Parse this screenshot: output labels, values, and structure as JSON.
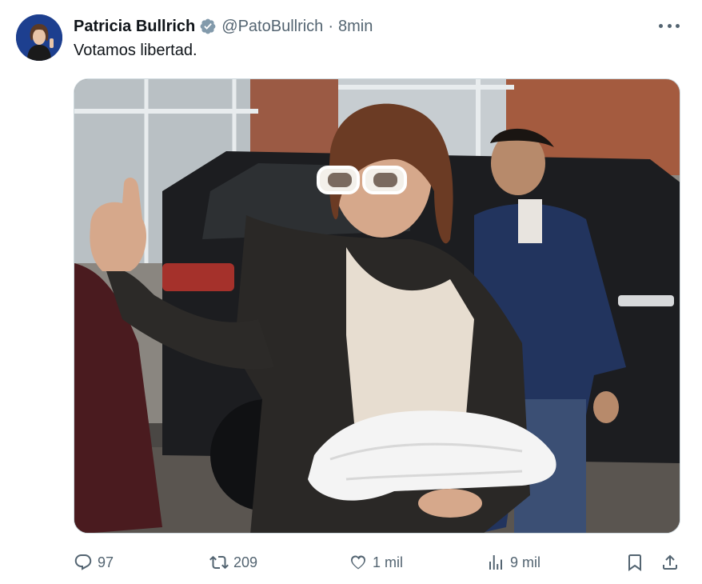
{
  "tweet": {
    "author_name": "Patricia Bullrich",
    "handle": "@PatoBullrich",
    "separator": "·",
    "time": "8min",
    "text": "Votamos libertad.",
    "more_icon": "more-horizontal-icon",
    "verified_icon": "verified-badge-icon"
  },
  "actions": {
    "replies": "97",
    "retweets": "209",
    "likes": "1 mil",
    "views": "9 mil",
    "reply_icon": "reply-icon",
    "retweet_icon": "retweet-icon",
    "like_icon": "heart-icon",
    "views_icon": "analytics-icon",
    "bookmark_icon": "bookmark-icon",
    "share_icon": "share-icon"
  },
  "colors": {
    "text_primary": "#0f1419",
    "text_secondary": "#536471",
    "verified_badge": "#829aab",
    "avatar_bg": "#1d3f8f"
  }
}
